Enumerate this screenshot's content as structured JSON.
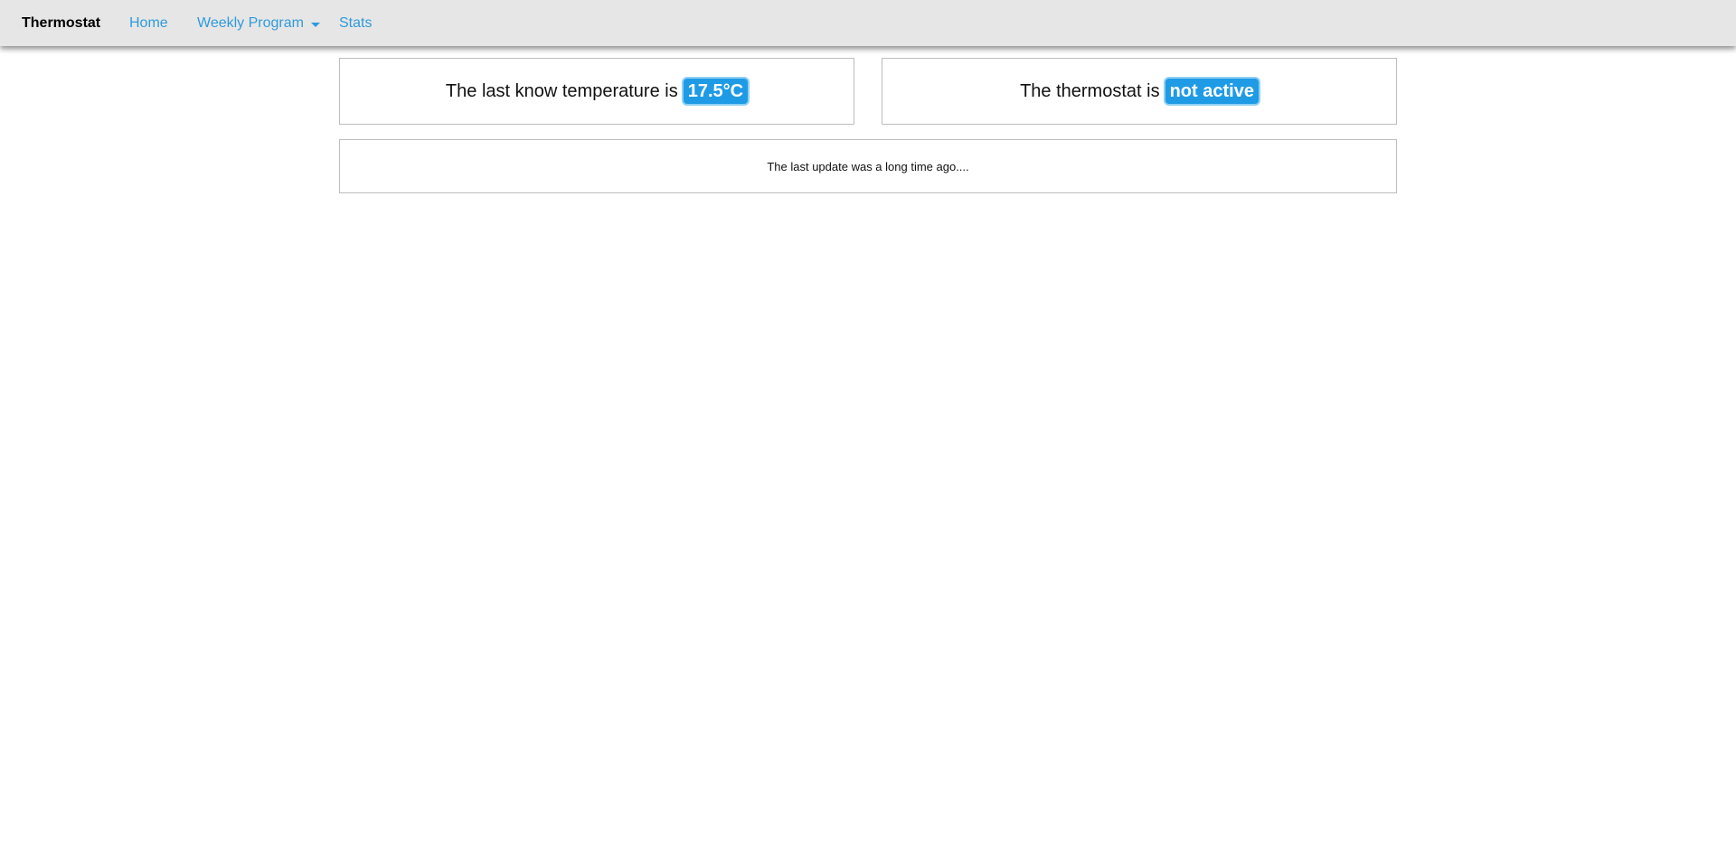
{
  "navbar": {
    "brand": "Thermostat",
    "items": [
      {
        "label": "Home"
      },
      {
        "label": "Weekly Program"
      },
      {
        "label": "Stats"
      }
    ]
  },
  "temperature_card": {
    "text": "The last know temperature is",
    "value": "17.5°C"
  },
  "status_card": {
    "text": "The thermostat is",
    "value": "not active"
  },
  "update_card": {
    "text": "The last update was a long time ago...."
  },
  "colors": {
    "accent": "#1f9be6",
    "link": "#2f9bdc",
    "navbar_bg": "#e6e6e6"
  }
}
